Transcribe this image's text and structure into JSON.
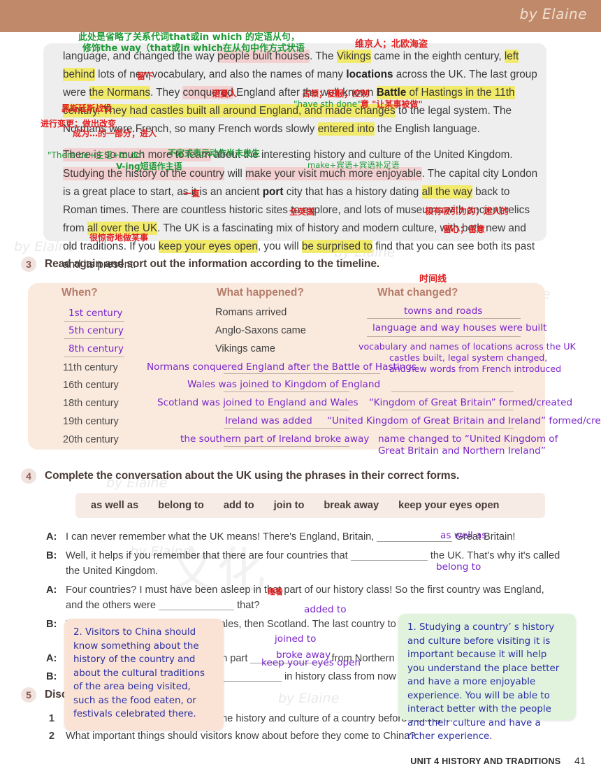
{
  "banner": {
    "signature": "by Elaine",
    "color": "#c08a6a"
  },
  "watermark": {
    "text": "by Elaine"
  },
  "passage": {
    "paragraph1_parts": [
      "language, and changed the way ",
      "people built houses",
      ". The ",
      "Vikings",
      " came in the eighth century, ",
      "left behind",
      " lots of new vocabulary, and also the names of many ",
      "locations",
      " across the UK. The last group were ",
      "the Normans",
      ". They ",
      "conquered",
      " England after the well-known ",
      "Battle",
      " of Hastings in the 11th century. They had castles built all around England, and ",
      "made changes",
      " to the legal system. The Normans were French, so many French words slowly ",
      "entered into",
      " the English language."
    ],
    "paragraph2_parts": [
      "There is so much more to learn",
      " about the interesting history and culture of the United Kingdom. ",
      "Studying the history of the country",
      " will ",
      "make your visit much more enjoyable",
      ". The capital city London is a great place to start, as it is an ancient ",
      "port",
      " city that has a history dating ",
      "all the way",
      " back to Roman times. There are countless historic sites to explore, and lots of museums with ancient relics from ",
      "all over the UK",
      ". The UK is a fascinating mix of history and modern culture, with both new and old traditions. If you ",
      "keep your eyes open",
      ", you will ",
      "be surprised to",
      " find that you can see both its past and its present."
    ]
  },
  "annotations": {
    "grammar_note_line1": "此处是省略了关系代词that或in which 的定语从句，",
    "grammar_note_line2": "修饰the way（that或in which在从句中作方式状语",
    "vikings_gloss": "维京人；北欧海盗",
    "left_behind_gloss": "留下",
    "normans_gloss": "诺曼人",
    "conquered_gloss": "占领；征服；控制",
    "battle_gloss": "黑斯廷斯战役",
    "have_sth_done": "\"have sth done\"",
    "have_sth_done_cn": "意 \"让某事被做\"",
    "made_changes_gloss": "进行变更；做出改变",
    "entered_into_gloss": "成为…的一部分；进入",
    "there_be_note": "\"There be+主语+to do\"",
    "infinitive_note": "不定式表示动作尚未发生",
    "ving_note": "V-ing短语作主语",
    "make_note": "make+宾语+宾语补足语",
    "all_the_way_gloss": "一直",
    "all_over_uk_gloss": "全英国",
    "fascinating_gloss": "极有吸引力的；迷人的",
    "keep_eyes_open_gloss": "留心；留意",
    "be_surprised_gloss": "很惊奇地做某事",
    "timeline_gloss": "时间线"
  },
  "task3": {
    "number": "3",
    "title": "Read again and sort out the information according to the timeline.",
    "columns": [
      "When?",
      "What happened?",
      "What changed?"
    ],
    "rows": [
      {
        "when": "1st century",
        "when_handwritten": true,
        "happened": "Romans arrived",
        "happened_handwritten": false,
        "changed": "towns and roads",
        "changed_handwritten": true
      },
      {
        "when": "5th century",
        "when_handwritten": true,
        "happened": "Anglo-Saxons came",
        "happened_handwritten": false,
        "changed": "language and way houses were built",
        "changed_handwritten": true
      },
      {
        "when": "8th century",
        "when_handwritten": true,
        "happened": "Vikings came",
        "happened_handwritten": false,
        "changed": "vocabulary and names of locations across the UK",
        "changed_handwritten": true
      },
      {
        "when": "11th century",
        "when_handwritten": false,
        "happened": "Normans conquered England after the Battle of Hastings",
        "happened_handwritten": true,
        "changed": "castles built,  legal system changed,",
        "changed2": "and new words from French introduced",
        "changed_handwritten": true
      },
      {
        "when": "16th century",
        "when_handwritten": false,
        "happened": "Wales was joined to Kingdom of England",
        "happened_handwritten": true,
        "changed": "",
        "changed_handwritten": true
      },
      {
        "when": "18th century",
        "when_handwritten": false,
        "happened": "Scotland was joined to England and Wales",
        "happened_handwritten": true,
        "changed": "“Kingdom of Great Britain”  formed/created",
        "changed_handwritten": true
      },
      {
        "when": "19th century",
        "when_handwritten": false,
        "happened": "Ireland was added",
        "happened_handwritten": true,
        "changed": "“United Kingdom of Great Britain and Ireland”  formed/created",
        "changed_handwritten": true
      },
      {
        "when": "20th century",
        "when_handwritten": false,
        "happened": "the southern part of Ireland broke away",
        "happened_handwritten": true,
        "changed": "name changed to  “United Kingdom of",
        "changed2": "Great Britain and Northern Ireland”",
        "changed_handwritten": true
      }
    ]
  },
  "task4": {
    "number": "4",
    "title": "Complete the conversation about the UK using the phrases in their correct forms.",
    "phrase_bank": [
      "as well as",
      "belong to",
      "add to",
      "join to",
      "break away",
      "keep your eyes open"
    ],
    "lines": [
      {
        "speaker": "A:",
        "before": "I can never remember what the UK means! There's England, Britain,",
        "answer": "as well as",
        "after": "Great Britain!"
      },
      {
        "speaker": "B:",
        "before": "Well, it helps if you remember that there are four countries that",
        "answer": "belong to",
        "after": "the UK. That's why it's called the United Kingdom."
      },
      {
        "speaker": "A:",
        "before": "Four countries? I must have been asleep in that part of our history class! So the first country was England, and the others were",
        "answer": "added to",
        "after": "that?"
      },
      {
        "speaker": "B:",
        "before": "You're right. First England, then Wales, then Scotland. The last country to be",
        "answer": "joined to",
        "after": "the United Kingdom was Ireland."
      },
      {
        "speaker": "A:",
        "before": "But in the 20th century the southern part",
        "answer": "broke away",
        "after": "from Northern Ireland."
      },
      {
        "speaker": "B:",
        "before": "Well remembered! But",
        "answer": "keep your eyes open",
        "after": "in history class from now on!"
      }
    ],
    "asleep_gloss": "睡着"
  },
  "task5": {
    "number": "5",
    "title": "Discuss the questions in groups.",
    "questions": [
      "Why is it important to know about the history and culture of a country before visiting it?",
      "What important things should visitors know about before they come to China?"
    ]
  },
  "sticky_notes": {
    "pink": "2. Visitors to China should know something about the history of the country and about the cultural traditions of the area being visited,  such as the food eaten,  or festivals celebrated there.",
    "green": "1. Studying a country’ s history and culture before visiting it is important because it will help you understand the place better and have a more enjoyable experience. You will be able to interact better with the people and their culture and have a richer experience."
  },
  "footer": {
    "unit": "UNIT 4 HISTORY AND TRADITIONS",
    "page": "41"
  },
  "colors": {
    "banner": "#c08a6a",
    "highlight_yellow": "#f2ea6b",
    "highlight_pink": "#f3cfcf",
    "handwriting_purple": "#7a26c9",
    "annotation_red": "#e02020",
    "annotation_green": "#1f9a36",
    "note_blue": "#2a2fa5"
  }
}
